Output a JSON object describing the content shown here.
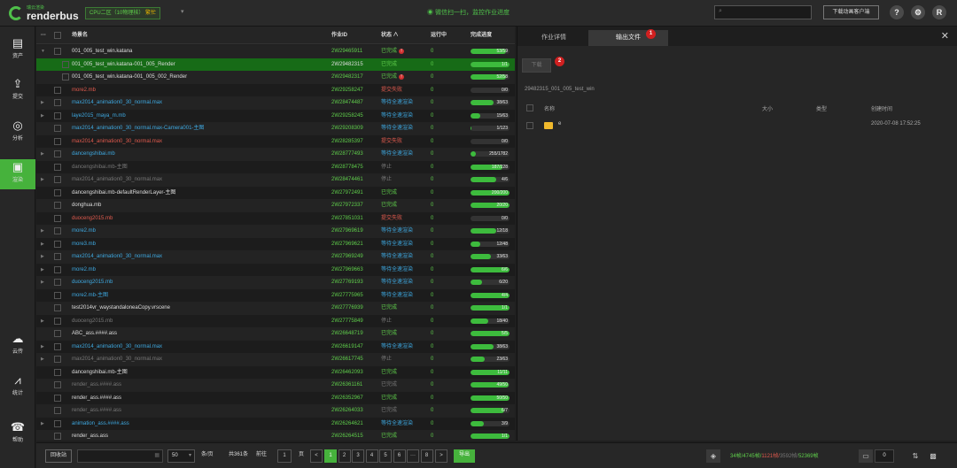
{
  "header": {
    "brand_small": "瑞云渲染",
    "brand": "renderbus",
    "region_prefix": "CPU二区（10物理核）",
    "region_status": "繁忙",
    "wechat_text": "微信扫一扫，监控作业进度",
    "search_placeholder": "",
    "download_client": "下载动画客户端",
    "help": "?",
    "settings": "⚙",
    "avatar": "R"
  },
  "sidebar": {
    "items": [
      {
        "icon": "▤",
        "label": "资产"
      },
      {
        "icon": "⇪",
        "label": "提交"
      },
      {
        "icon": "◎",
        "label": "分析"
      },
      {
        "icon": "▣",
        "label": "渲染"
      },
      {
        "icon": "☁",
        "label": "云传"
      },
      {
        "icon": "⩘",
        "label": "统计"
      },
      {
        "icon": "☎",
        "label": "帮助"
      }
    ]
  },
  "table": {
    "headers": {
      "more": "···",
      "name": "场景名",
      "job_id": "作业ID",
      "status": "状态 ∧",
      "running": "运行中",
      "progress": "完成进度"
    },
    "rows": [
      {
        "name": "001_005_test_win.katana",
        "id": "2W29465911",
        "status": "已完成",
        "warn": true,
        "run": "0",
        "prog": "53/59",
        "pct": 0.9,
        "color": "c-white",
        "scolor": "c-green",
        "expand": "▼",
        "indent": 0
      },
      {
        "name": "001_005_test_win.katana-001_005_Render",
        "id": "2W29482315",
        "status": "已完成",
        "warn": false,
        "run": "0",
        "prog": "1/1",
        "pct": 1,
        "color": "c-white",
        "scolor": "c-green",
        "expand": "",
        "indent": 1,
        "sel": true
      },
      {
        "name": "001_005_test_win.katana-001_005_002_Render",
        "id": "2W29482317",
        "status": "已完成",
        "warn": true,
        "run": "0",
        "prog": "52/58",
        "pct": 0.9,
        "color": "c-white",
        "scolor": "c-green",
        "expand": "",
        "indent": 1
      },
      {
        "name": "more2.mb",
        "id": "2W29258247",
        "status": "提交失败",
        "warn": false,
        "run": "0",
        "prog": "0/0",
        "pct": 0,
        "color": "c-red",
        "scolor": "c-red",
        "expand": "",
        "indent": 0
      },
      {
        "name": "max2014_animation0_30_normal.max",
        "id": "2W28474487",
        "status": "等待全速渲染",
        "warn": false,
        "run": "0",
        "prog": "38/63",
        "pct": 0.6,
        "color": "c-blue",
        "scolor": "c-blue",
        "expand": "▶",
        "indent": 0
      },
      {
        "name": "laye2015_maya_m.mb",
        "id": "2W29258245",
        "status": "等待全速渲染",
        "warn": false,
        "run": "0",
        "prog": "15/63",
        "pct": 0.24,
        "color": "c-blue",
        "scolor": "c-blue",
        "expand": "▶",
        "indent": 0
      },
      {
        "name": "max2014_animation0_30_normal.max-Camera001-主图",
        "id": "2W29208309",
        "status": "等待全速渲染",
        "warn": false,
        "run": "0",
        "prog": "1/123",
        "pct": 0.01,
        "color": "c-blue",
        "scolor": "c-blue",
        "expand": "",
        "indent": 0
      },
      {
        "name": "max2014_animation0_30_normal.max",
        "id": "2W28285397",
        "status": "提交失败",
        "warn": false,
        "run": "0",
        "prog": "0/0",
        "pct": 0,
        "color": "c-red",
        "scolor": "c-red",
        "expand": "",
        "indent": 0
      },
      {
        "name": "dancengshibai.mb",
        "id": "2W28777493",
        "status": "等待全速渲染",
        "warn": false,
        "run": "0",
        "prog": "255/1782",
        "pct": 0.14,
        "color": "c-blue",
        "scolor": "c-blue",
        "expand": "▶",
        "indent": 0
      },
      {
        "name": "dancengshibai.mb-主图",
        "id": "2W28778475",
        "status": "停止",
        "warn": false,
        "run": "0",
        "prog": "187/228",
        "pct": 0.82,
        "color": "c-gray",
        "scolor": "c-gray",
        "expand": "",
        "indent": 0
      },
      {
        "name": "max2014_animation0_30_normal.max",
        "id": "2W28474461",
        "status": "停止",
        "warn": false,
        "run": "0",
        "prog": "4/6",
        "pct": 0.67,
        "color": "c-gray",
        "scolor": "c-gray",
        "expand": "▶",
        "indent": 0
      },
      {
        "name": "dancengshibai.mb-defaultRenderLayer-主图",
        "id": "2W27972491",
        "status": "已完成",
        "warn": false,
        "run": "0",
        "prog": "200/200",
        "pct": 1,
        "color": "c-white",
        "scolor": "c-green",
        "expand": "",
        "indent": 0
      },
      {
        "name": "donghua.mb",
        "id": "2W27972337",
        "status": "已完成",
        "warn": false,
        "run": "0",
        "prog": "20/20",
        "pct": 1,
        "color": "c-white",
        "scolor": "c-green",
        "expand": "",
        "indent": 0
      },
      {
        "name": "duoceng2015.mb",
        "id": "2W27851031",
        "status": "提交失败",
        "warn": false,
        "run": "0",
        "prog": "0/0",
        "pct": 0,
        "color": "c-red",
        "scolor": "c-red",
        "expand": "",
        "indent": 0
      },
      {
        "name": "more2.mb",
        "id": "2W27969619",
        "status": "等待全速渲染",
        "warn": false,
        "run": "0",
        "prog": "12/18",
        "pct": 0.67,
        "color": "c-blue",
        "scolor": "c-blue",
        "expand": "▶",
        "indent": 0
      },
      {
        "name": "more3.mb",
        "id": "2W27969621",
        "status": "等待全速渲染",
        "warn": false,
        "run": "0",
        "prog": "12/48",
        "pct": 0.25,
        "color": "c-blue",
        "scolor": "c-blue",
        "expand": "▶",
        "indent": 0
      },
      {
        "name": "max2014_animation0_30_normal.max",
        "id": "2W27969249",
        "status": "等待全速渲染",
        "warn": false,
        "run": "0",
        "prog": "33/63",
        "pct": 0.52,
        "color": "c-blue",
        "scolor": "c-blue",
        "expand": "▶",
        "indent": 0
      },
      {
        "name": "more2.mb",
        "id": "2W27969663",
        "status": "等待全速渲染",
        "warn": false,
        "run": "0",
        "prog": "6/6",
        "pct": 1,
        "color": "c-blue",
        "scolor": "c-blue",
        "expand": "▶",
        "indent": 0
      },
      {
        "name": "duoceng2015.mb",
        "id": "2W27769193",
        "status": "等待全速渲染",
        "warn": false,
        "run": "0",
        "prog": "6/20",
        "pct": 0.3,
        "color": "c-blue",
        "scolor": "c-blue",
        "expand": "▶",
        "indent": 0
      },
      {
        "name": "more2.mb-主图",
        "id": "2W27775965",
        "status": "等待全速渲染",
        "warn": false,
        "run": "0",
        "prog": "4/4",
        "pct": 1,
        "color": "c-blue",
        "scolor": "c-blue",
        "expand": "",
        "indent": 0
      },
      {
        "name": "test2014vr_waystandaloneaCopy.vrscene",
        "id": "2W27776939",
        "status": "已完成",
        "warn": false,
        "run": "0",
        "prog": "1/1",
        "pct": 1,
        "color": "c-white",
        "scolor": "c-green",
        "expand": "",
        "indent": 0
      },
      {
        "name": "duoceng2015.mb",
        "id": "2W27775849",
        "status": "停止",
        "warn": false,
        "run": "0",
        "prog": "18/40",
        "pct": 0.45,
        "color": "c-gray",
        "scolor": "c-gray",
        "expand": "▶",
        "indent": 0
      },
      {
        "name": "ABC_ass.####.ass",
        "id": "2W26648719",
        "status": "已完成",
        "warn": false,
        "run": "0",
        "prog": "5/5",
        "pct": 1,
        "color": "c-white",
        "scolor": "c-green",
        "expand": "",
        "indent": 0
      },
      {
        "name": "max2014_animation0_30_normal.max",
        "id": "2W26619147",
        "status": "等待全速渲染",
        "warn": false,
        "run": "0",
        "prog": "38/63",
        "pct": 0.6,
        "color": "c-blue",
        "scolor": "c-blue",
        "expand": "▶",
        "indent": 0
      },
      {
        "name": "max2014_animation0_30_normal.max",
        "id": "2W26617745",
        "status": "停止",
        "warn": false,
        "run": "0",
        "prog": "23/63",
        "pct": 0.37,
        "color": "c-gray",
        "scolor": "c-gray",
        "expand": "▶",
        "indent": 0
      },
      {
        "name": "dancengshibai.mb-主图",
        "id": "2W26462093",
        "status": "已完成",
        "warn": false,
        "run": "0",
        "prog": "11/11",
        "pct": 1,
        "color": "c-white",
        "scolor": "c-green",
        "expand": "",
        "indent": 0
      },
      {
        "name": "render_ass.####.ass",
        "id": "2W26361161",
        "status": "已完成",
        "warn": false,
        "run": "0",
        "prog": "49/50",
        "pct": 0.98,
        "color": "c-gray",
        "scolor": "c-gray",
        "expand": "",
        "indent": 0
      },
      {
        "name": "render_ass.####.ass",
        "id": "2W26352967",
        "status": "已完成",
        "warn": false,
        "run": "0",
        "prog": "50/50",
        "pct": 1,
        "color": "c-white",
        "scolor": "c-green",
        "expand": "",
        "indent": 0
      },
      {
        "name": "render_ass.####.ass",
        "id": "2W26264033",
        "status": "已完成",
        "warn": false,
        "run": "0",
        "prog": "6/7",
        "pct": 0.86,
        "color": "c-gray",
        "scolor": "c-gray",
        "expand": "",
        "indent": 0
      },
      {
        "name": "animation_ass.####.ass",
        "id": "2W26264621",
        "status": "等待全速渲染",
        "warn": false,
        "run": "0",
        "prog": "3/9",
        "pct": 0.33,
        "color": "c-blue",
        "scolor": "c-blue",
        "expand": "▶",
        "indent": 0
      },
      {
        "name": "render_ass.ass",
        "id": "2W26264515",
        "status": "已完成",
        "warn": false,
        "run": "0",
        "prog": "1/1",
        "pct": 1,
        "color": "c-white",
        "scolor": "c-green",
        "expand": "",
        "indent": 0
      }
    ]
  },
  "panel": {
    "tab_details": "作业详情",
    "tab_output": "输出文件",
    "badge_1": "1",
    "download": "下载",
    "badge_2": "2",
    "path": "29482315_001_005_test_win",
    "col_name": "名称",
    "col_size": "大小",
    "col_type": "类型",
    "col_created": "创建时间",
    "file_name": "e",
    "file_created": "2020-07-08 17:52:25",
    "close": "✕"
  },
  "footer": {
    "recycle": "回收站",
    "filter_placeholder": "",
    "page_size": "50",
    "per_page": "条/页",
    "total": "共361条",
    "goto": "前往",
    "goto_value": "1",
    "page_unit": "页",
    "pages": [
      "1",
      "2",
      "3",
      "4",
      "5",
      "6",
      "···",
      "8"
    ],
    "prev": "<",
    "next": ">",
    "export": "导出",
    "stats_done": "34帧/4745帧/",
    "stats_fail": "1121帧/",
    "stats_wait": "3592帧/",
    "stats_total": "52369帧",
    "count_value": "0"
  }
}
